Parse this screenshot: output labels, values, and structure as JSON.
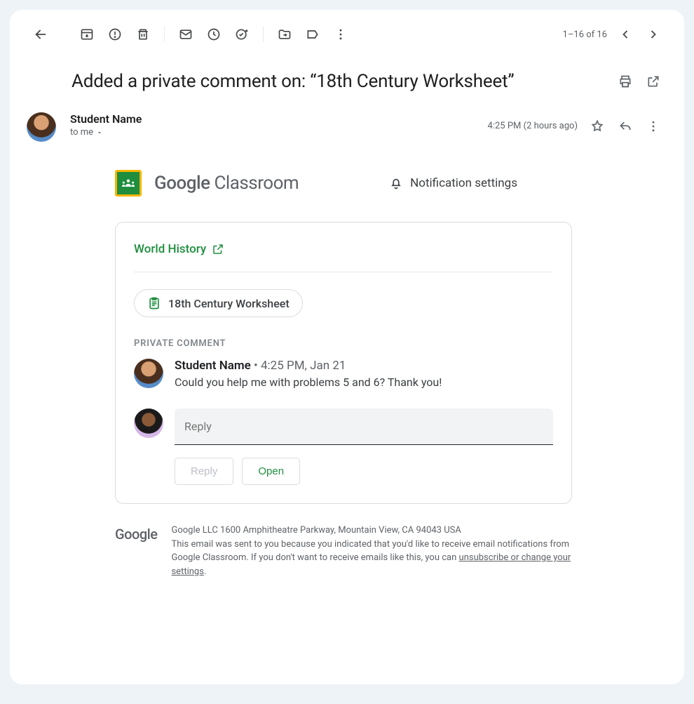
{
  "toolbar": {
    "count": "1–16 of 16"
  },
  "subject": "Added a private comment on: “18th Century Worksheet”",
  "sender": {
    "name": "Student Name",
    "to_label": "to me",
    "timestamp": "4:25 PM (2 hours ago)"
  },
  "brand": {
    "google": "Google",
    "classroom": " Classroom",
    "notif_label": "Notification settings"
  },
  "card": {
    "class_name": "World History",
    "assignment": "18th Century Worksheet",
    "pc_label": "Private Comment",
    "comment": {
      "author": "Student Name",
      "time": "4:25 PM, Jan 21",
      "text": "Could you help me with problems 5 and 6? Thank you!"
    },
    "reply_placeholder": "Reply",
    "reply_btn": "Reply",
    "open_btn": "Open"
  },
  "footer": {
    "logo": "Google",
    "line1": "Google LLC 1600 Amphitheatre Parkway, Mountain View, CA 94043 USA",
    "line2a": "This email was sent to you because you indicated that you'd like to receive email notifications from Google Classroom. If you don't want to receive emails like this, you can ",
    "unsub": "unsubscribe or change your settings",
    "dot": "."
  }
}
